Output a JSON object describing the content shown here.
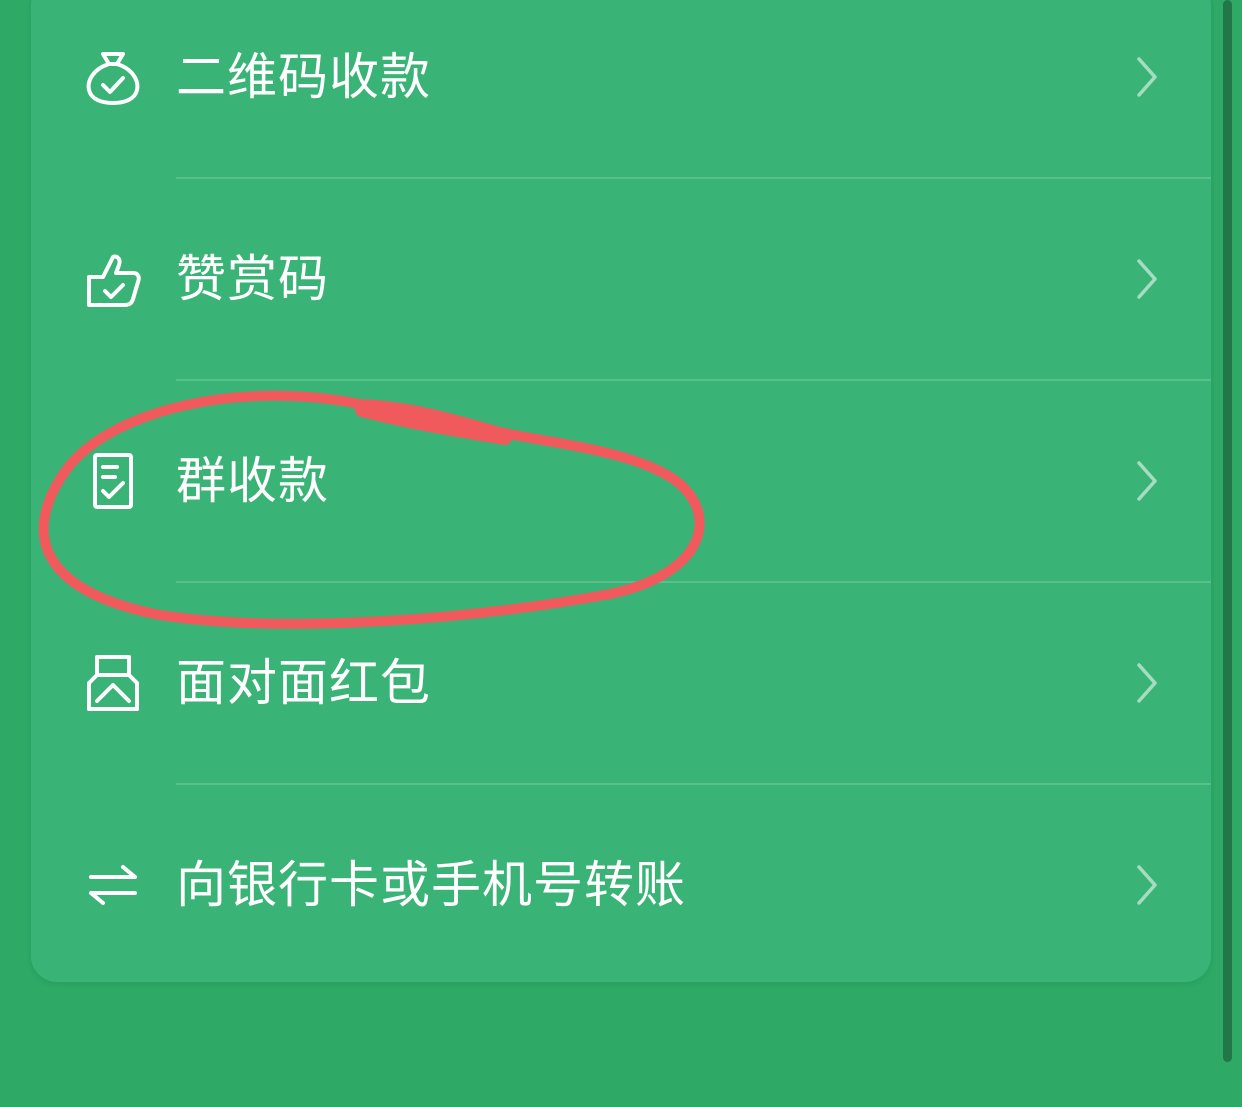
{
  "menu": {
    "items": [
      {
        "label": "二维码收款",
        "icon": "money-bag-check-icon"
      },
      {
        "label": "赞赏码",
        "icon": "thumbs-up-check-icon"
      },
      {
        "label": "群收款",
        "icon": "document-check-icon"
      },
      {
        "label": "面对面红包",
        "icon": "red-envelope-icon"
      },
      {
        "label": "向银行卡或手机号转账",
        "icon": "transfer-arrows-icon"
      }
    ],
    "chevron_icon": "chevron-right-icon"
  },
  "annotation": {
    "shape": "hand-drawn-circle",
    "target": "群收款"
  },
  "colors": {
    "background": "#2ea966",
    "card": "#39b476",
    "text": "#ffffff",
    "chevron": "#a6dcc0",
    "annotation": "#f15a5c",
    "scrollbar": "#1f6e42"
  }
}
